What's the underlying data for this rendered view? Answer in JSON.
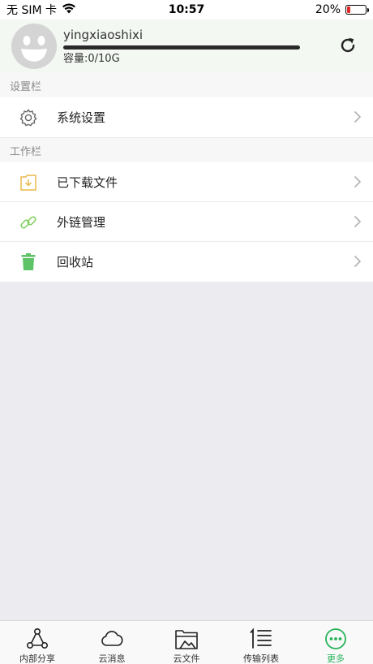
{
  "status_bar": {
    "carrier": "无 SIM 卡",
    "time": "10:57",
    "battery": "20%",
    "battery_level": 0.2
  },
  "profile": {
    "username": "yingxiaoshixi",
    "capacity": "容量:0/10G"
  },
  "sections": {
    "settings_label": "设置栏",
    "work_label": "工作栏"
  },
  "settings_items": [
    {
      "label": "系统设置",
      "icon": "gear-icon"
    }
  ],
  "work_items": [
    {
      "label": "已下载文件",
      "icon": "download-folder-icon"
    },
    {
      "label": "外链管理",
      "icon": "link-icon"
    },
    {
      "label": "回收站",
      "icon": "trash-icon"
    }
  ],
  "tabs": [
    {
      "label": "内部分享",
      "icon": "share-network-icon",
      "active": false
    },
    {
      "label": "云消息",
      "icon": "cloud-icon",
      "active": false
    },
    {
      "label": "云文件",
      "icon": "folder-icon",
      "active": false
    },
    {
      "label": "传输列表",
      "icon": "transfer-list-icon",
      "active": false
    },
    {
      "label": "更多",
      "icon": "more-icon",
      "active": true
    }
  ],
  "colors": {
    "accent": "#27b35a",
    "download_icon": "#e8b84a",
    "link_icon": "#7ccf5a",
    "trash_icon": "#5ec267",
    "battery_low": "#e02a2a"
  }
}
